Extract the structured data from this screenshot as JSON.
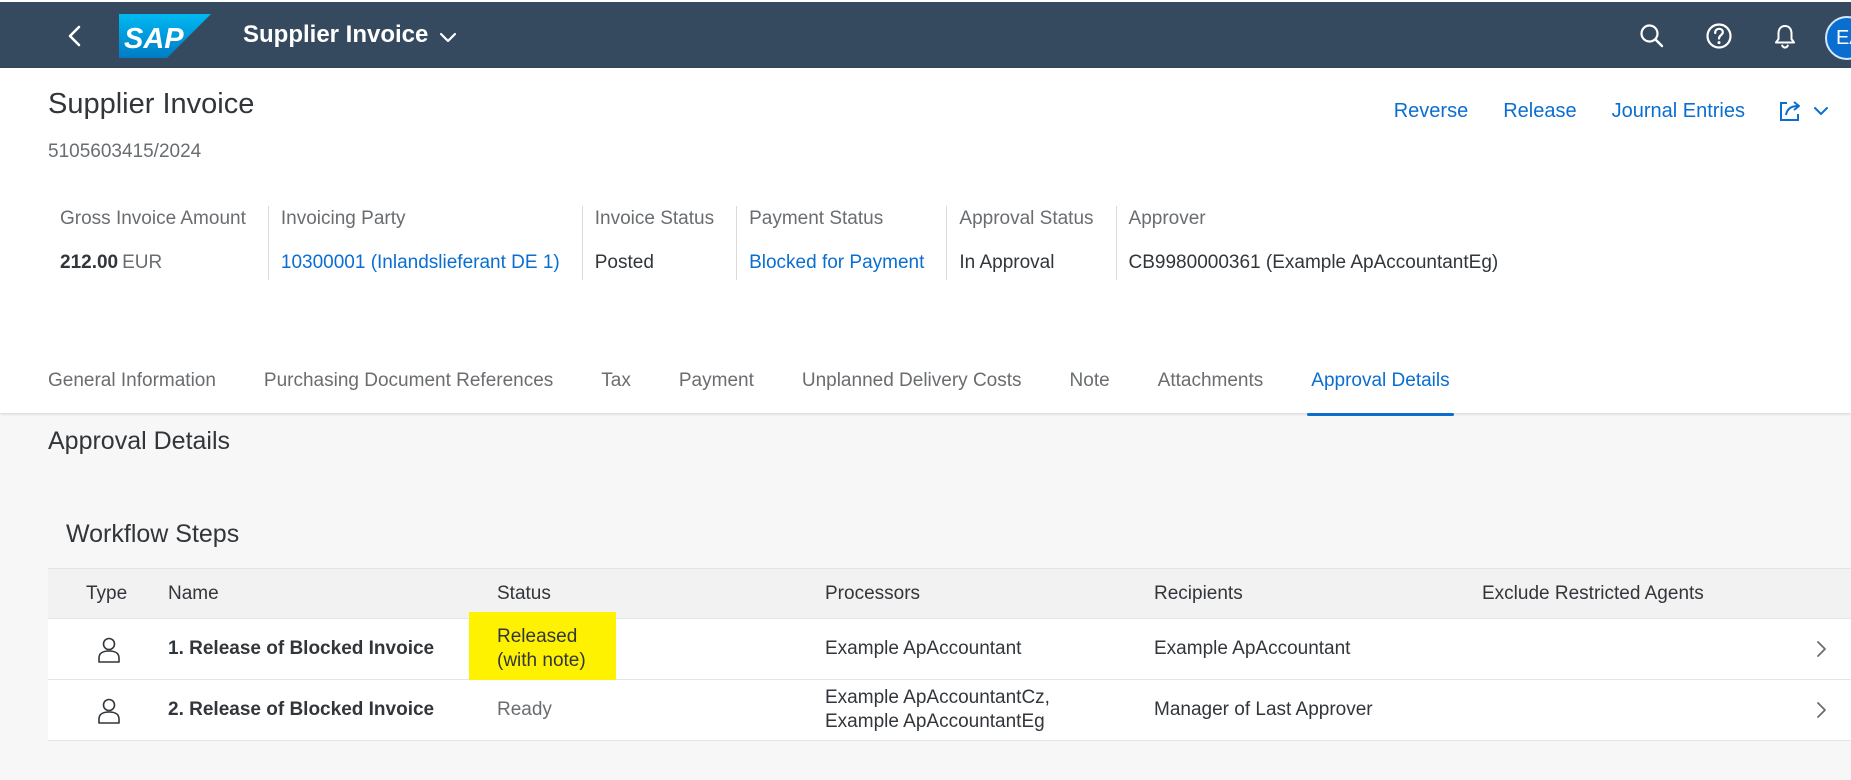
{
  "shell": {
    "logo_text": "SAP",
    "app_title": "Supplier Invoice",
    "avatar_initials": "EA"
  },
  "header": {
    "title": "Supplier Invoice",
    "subtitle": "5105603415/2024",
    "actions": [
      "Reverse",
      "Release",
      "Journal Entries"
    ]
  },
  "kpis": {
    "gross_label": "Gross Invoice Amount",
    "gross_amount": "212.00",
    "gross_currency": "EUR",
    "party_label": "Invoicing Party",
    "party_value": "10300001 (Inlandslieferant DE 1)",
    "invoice_status_label": "Invoice Status",
    "invoice_status_value": "Posted",
    "payment_status_label": "Payment Status",
    "payment_status_value": "Blocked for Payment",
    "approval_status_label": "Approval Status",
    "approval_status_value": "In Approval",
    "approver_label": "Approver",
    "approver_value": "CB9980000361 (Example ApAccountantEg)"
  },
  "tabs": [
    "General Information",
    "Purchasing Document References",
    "Tax",
    "Payment",
    "Unplanned Delivery Costs",
    "Note",
    "Attachments",
    "Approval Details"
  ],
  "active_tab": "Approval Details",
  "content": {
    "section_title": "Approval Details",
    "panel_title": "Workflow Steps",
    "columns": [
      "Type",
      "Name",
      "Status",
      "Processors",
      "Recipients",
      "Exclude Restricted Agents"
    ],
    "rows": [
      {
        "name": "1. Release of Blocked Invoice",
        "status_line1": "Released",
        "status_line2": "(with note)",
        "processors_line1": "Example ApAccountant",
        "processors_line2": "",
        "recipients": "Example ApAccountant",
        "exclude": ""
      },
      {
        "name": "2. Release of Blocked Invoice",
        "status_line1": "Ready",
        "status_line2": "",
        "processors_line1": "Example ApAccountantCz,",
        "processors_line2": "Example ApAccountantEg",
        "recipients": "Manager of Last Approver",
        "exclude": ""
      }
    ]
  },
  "colors": {
    "shell_bg": "#354a5f",
    "link": "#0a6ed1",
    "highlight": "#fff200"
  }
}
